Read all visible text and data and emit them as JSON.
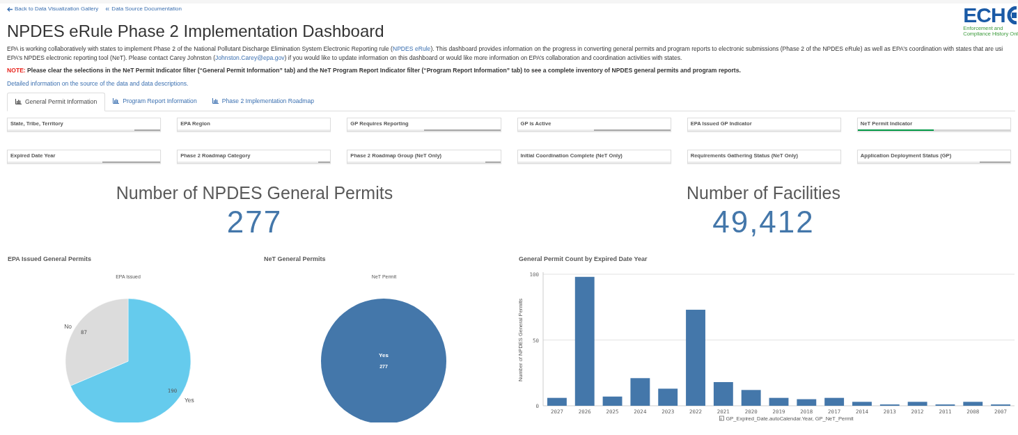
{
  "top_links": [
    {
      "kind": "back",
      "label": "Back to Data Visualization Gallery"
    },
    {
      "kind": "chevrons",
      "label": "Data Source Documentation"
    }
  ],
  "logo": {
    "wordmark": "ECH",
    "line1": "Enforcement and",
    "line2": "Compliance History Onl"
  },
  "title": "NPDES eRule Phase 2 Implementation Dashboard",
  "intro_lines": [
    [
      {
        "kind": "text",
        "text": "EPA is working collaboratively with states to implement Phase 2 of the National Pollutant Discharge Elimination System Electronic Reporting rule ("
      },
      {
        "kind": "link",
        "text": "NPDES eRule"
      },
      {
        "kind": "text",
        "text": "). This dashboard provides information on the progress in converting general permits and program reports to electronic submissions (Phase 2 of the NPDES eRule) as well as EPA’s coordination with states that are usi"
      }
    ],
    [
      {
        "kind": "text",
        "text": "EPA’s NPDES electronic reporting tool (NeT). Please contact Carey Johnston ("
      },
      {
        "kind": "link",
        "text": "Johnston.Carey@epa.gov"
      },
      {
        "kind": "text",
        "text": ") if you would like to update information on this dashboard or would like more information on EPA’s collaboration and coordination activities with states."
      }
    ]
  ],
  "note": {
    "label": "NOTE:",
    "text": "Please clear the selections in the NeT Permit Indicator filter (“General Permit Information” tab) and the NeT Program Report Indicator filter (“Program Report Information” tab) to see a complete inventory of NPDES general permits and program reports."
  },
  "details_link": "Detailed information on the source of the data and data descriptions.",
  "tabs": [
    {
      "label": "General Permit Information",
      "selected": true
    },
    {
      "label": "Program Report Information",
      "selected": false
    },
    {
      "label": "Phase 2 Implementation Roadmap",
      "selected": false
    }
  ],
  "filters": [
    {
      "label": "State, Tribe, Territory",
      "level": 0.17,
      "selected": false
    },
    {
      "label": "EPA Region",
      "level": 0,
      "selected": false
    },
    {
      "label": "GP Requires Reporting",
      "level": 0.5,
      "selected": false
    },
    {
      "label": "GP is Active",
      "level": 0.5,
      "selected": false
    },
    {
      "label": "EPA Issued GP Indicator",
      "level": 0,
      "selected": false
    },
    {
      "label": "NeT Permit Indicator",
      "level": 0.5,
      "selected": true
    },
    {
      "label": "Expired Date Year",
      "level": 0.38,
      "selected": false
    },
    {
      "label": "Phase 2 Roadmap Category",
      "level": 0.08,
      "selected": false
    },
    {
      "label": "Phase 2 Roadmap Group (NeT Only)",
      "level": 0.1,
      "selected": false
    },
    {
      "label": "Initial Coordination Complete (NeT Only)",
      "level": 0,
      "selected": false
    },
    {
      "label": "Requirements Gathering Status (NeT Only)",
      "level": 0,
      "selected": false
    },
    {
      "label": "Application Deployment Status (GP)",
      "level": 0.2,
      "selected": false
    }
  ],
  "kpis": [
    {
      "title": "Number of NPDES General Permits",
      "value": "277"
    },
    {
      "title": "Number of Facilities",
      "value": "49,412"
    }
  ],
  "pie_panels": [
    {
      "title": "EPA Issued General Permits",
      "chart_data": {
        "type": "pie",
        "title": "EPA Issued",
        "categories": [
          "Yes",
          "No"
        ],
        "values": [
          190,
          87
        ],
        "value_labels": [
          "190",
          "87"
        ]
      }
    },
    {
      "title": "NeT General Permits",
      "chart_data": {
        "type": "pie",
        "title": "NeT Permit",
        "categories": [
          "Yes"
        ],
        "values": [
          277
        ],
        "value_labels": [
          "277"
        ]
      }
    }
  ],
  "bar_panel": {
    "title": "General Permit Count by Expired Date Year",
    "chart_data": {
      "type": "bar",
      "xlabel": "GP_Expired_Date.autoCalendar.Year, GP_NeT_Permit",
      "ylabel": "Number of NPDES General Permits",
      "categories": [
        "2027",
        "2026",
        "2025",
        "2024",
        "2023",
        "2022",
        "2021",
        "2020",
        "2019",
        "2018",
        "2017",
        "2014",
        "2013",
        "2012",
        "2011",
        "2008",
        "2007"
      ],
      "values": [
        6,
        98,
        7,
        21,
        13,
        73,
        18,
        12,
        6,
        5,
        6,
        3,
        1,
        3,
        1,
        3,
        1
      ],
      "ylim": [
        0,
        100
      ],
      "yticks": [
        0,
        50,
        100
      ]
    }
  }
}
